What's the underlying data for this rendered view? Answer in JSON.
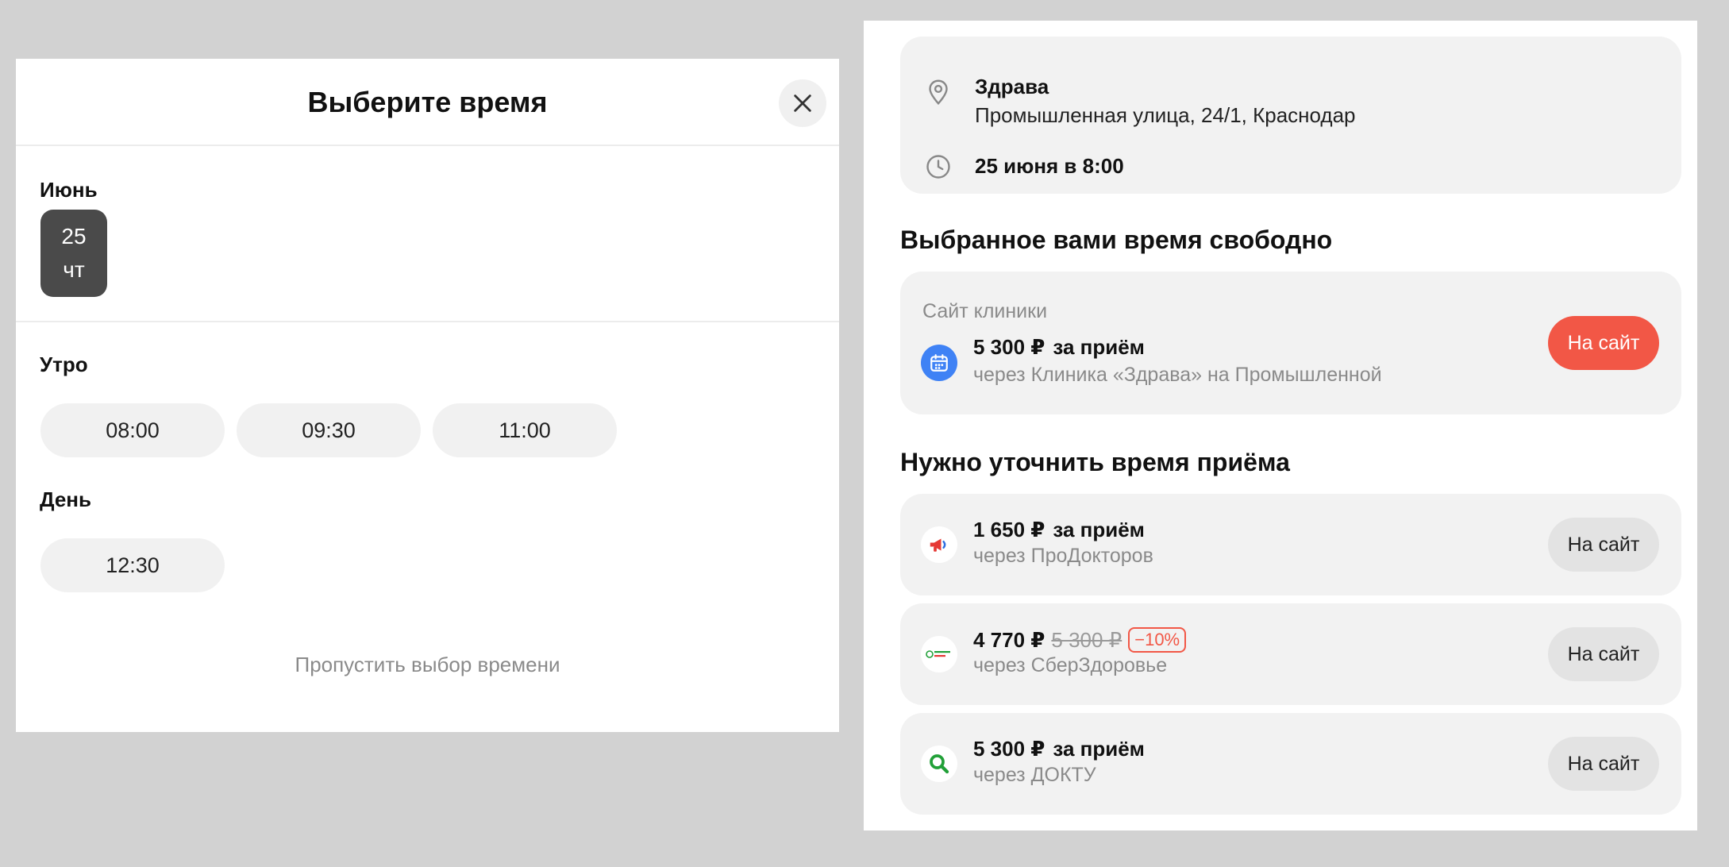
{
  "left": {
    "title": "Выберите время",
    "month": "Июнь",
    "date": {
      "day": "25",
      "weekday": "чт"
    },
    "morning_label": "Утро",
    "morning_slots": [
      "08:00",
      "09:30",
      "11:00"
    ],
    "day_label": "День",
    "day_slots": [
      "12:30"
    ],
    "skip": "Пропустить выбор времени"
  },
  "right": {
    "clinic_name": "Здрава",
    "address": "Промышленная улица, 24/1, Краснодар",
    "datetime": "25 июня в 8:00",
    "free_heading": "Выбранное вами время свободно",
    "clinic_site": {
      "label": "Сайт клиники",
      "price": "5 300 ₽",
      "price_suffix": "за приём",
      "via": "через Клиника «Здрава» на Промышленной",
      "button": "На сайт"
    },
    "clarify_heading": "Нужно уточнить время приёма",
    "offers": [
      {
        "price": "1 650 ₽",
        "price_suffix": "за приём",
        "via": "через ПроДокторов",
        "button": "На сайт",
        "icon": "megaphone-icon"
      },
      {
        "price": "4 770 ₽",
        "old_price": "5 300 ₽",
        "discount": "−10%",
        "via": "через СберЗдоровье",
        "button": "На сайт",
        "icon": "sberzdorovie-logo-icon"
      },
      {
        "price": "5 300 ₽",
        "price_suffix": "за приём",
        "via": "через ДОКТУ",
        "button": "На сайт",
        "icon": "magnifier-icon"
      }
    ]
  },
  "colors": {
    "accent": "#f25746",
    "calendar_blue": "#3f82f5",
    "date_chip": "#4a4a4a",
    "card_bg": "#f2f2f2",
    "page_bg": "#d2d2d2"
  }
}
